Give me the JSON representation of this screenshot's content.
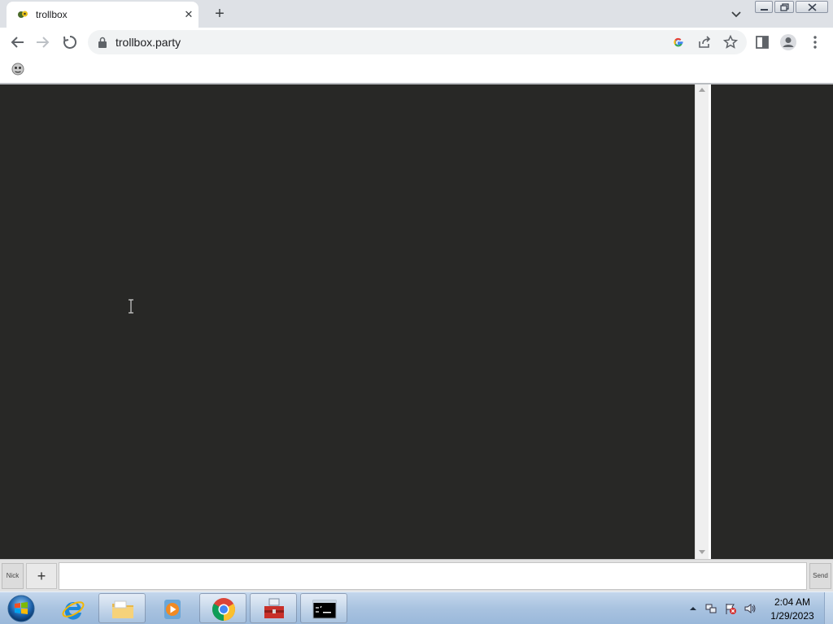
{
  "browser": {
    "tab": {
      "title": "trollbox",
      "favicon": "trollbox-favicon",
      "close_label": "✕"
    },
    "new_tab_label": "+",
    "omnibox": {
      "url": "trollbox.party",
      "lock_icon": "lock-icon"
    },
    "toolbar_icons": [
      "back-arrow-icon",
      "forward-arrow-icon",
      "stop-loading-icon",
      "google-g-icon",
      "share-icon",
      "star-icon",
      "side-panel-icon",
      "profile-icon",
      "kebab-menu-icon"
    ],
    "window_controls": [
      "minimize-icon",
      "restore-icon",
      "close-icon"
    ],
    "bookmark_icon": "bookmark-favicon"
  },
  "page": {
    "chat_bg": "#282826",
    "input_bar": {
      "nick_label": "Nick",
      "plus_label": "+",
      "message_placeholder": "",
      "message_value": "",
      "send_label": "Send"
    }
  },
  "taskbar": {
    "start_icon": "windows-start-orb-icon",
    "apps": [
      "internet-explorer-icon",
      "file-explorer-icon",
      "media-player-icon",
      "chrome-icon",
      "toolbox-icon",
      "command-prompt-icon"
    ],
    "tray_icons": [
      "show-hidden-icons-arrow",
      "network-icon",
      "action-center-flag-icon",
      "volume-icon"
    ],
    "clock": {
      "time": "2:04 AM",
      "date": "1/29/2023"
    }
  }
}
